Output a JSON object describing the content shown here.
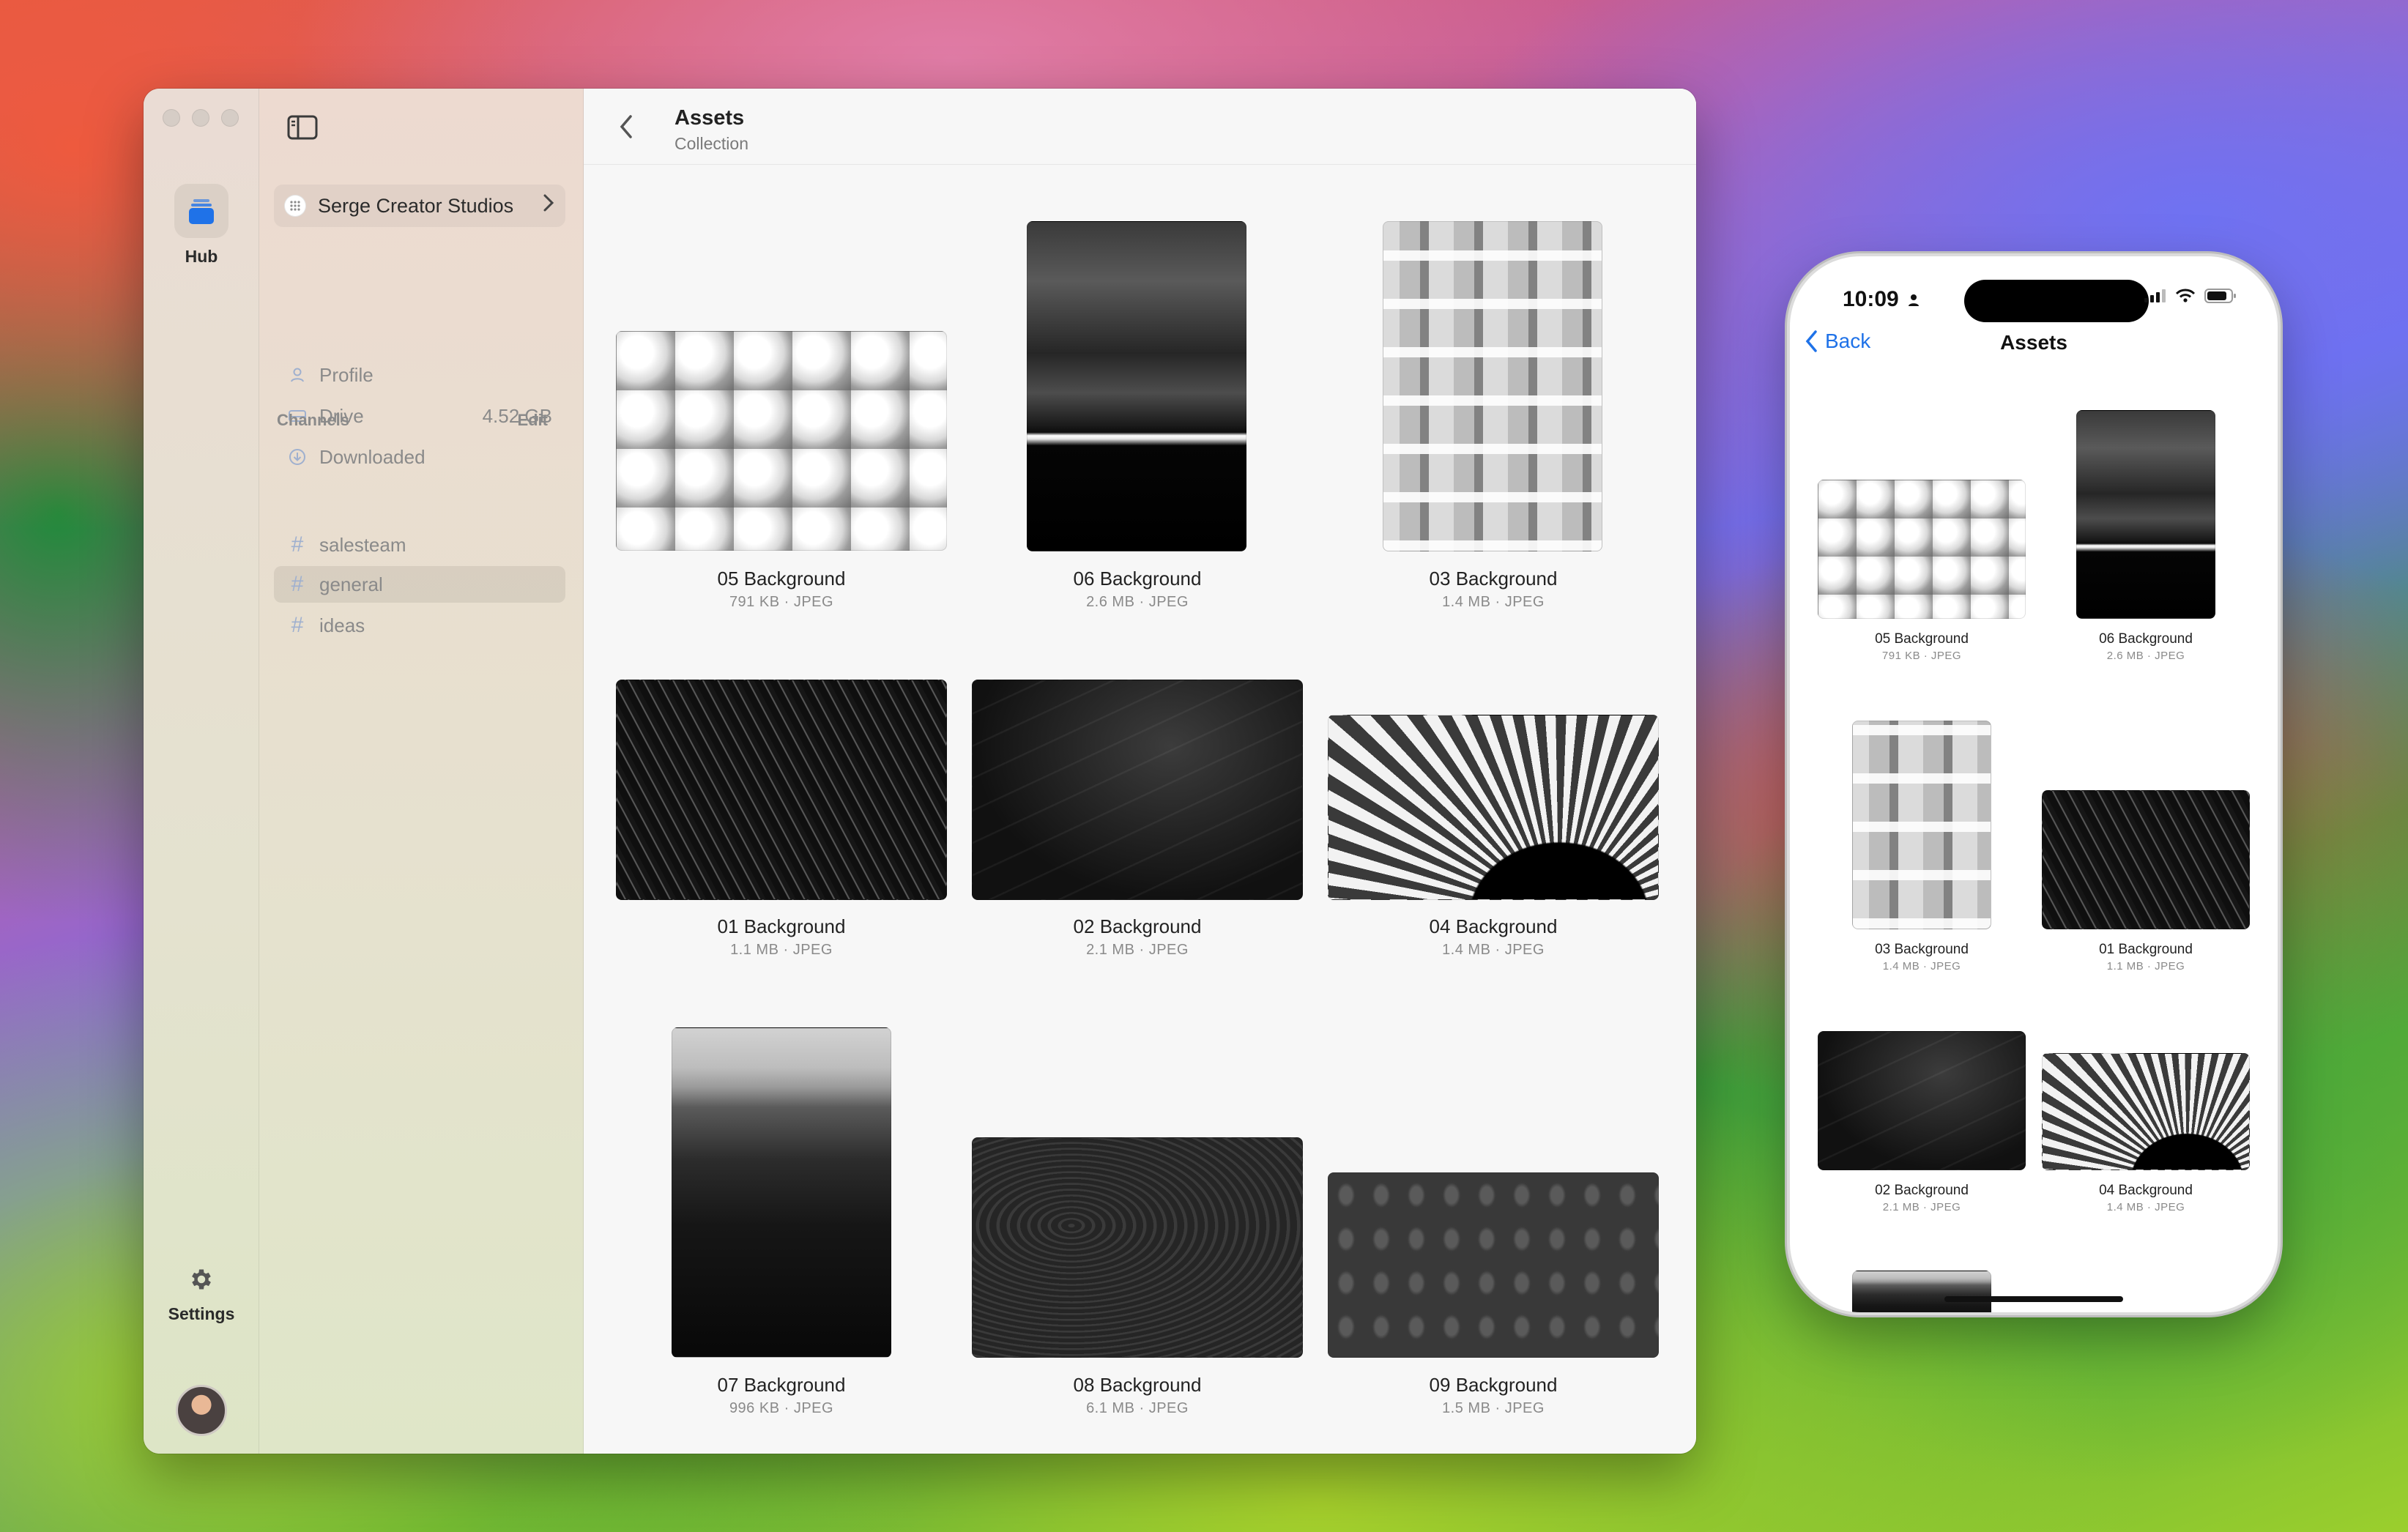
{
  "mac": {
    "rail": {
      "hub_label": "Hub",
      "settings_label": "Settings"
    },
    "sidebar": {
      "org_name": "Serge Creator Studios",
      "items": [
        {
          "label": "Profile",
          "icon": "person-icon"
        },
        {
          "label": "Drive",
          "icon": "drive-icon",
          "meta": "4.52 GB"
        },
        {
          "label": "Downloaded",
          "icon": "download-icon"
        }
      ],
      "channels_heading": "Channels",
      "channels_edit": "Edit",
      "channels": [
        {
          "label": "salesteam"
        },
        {
          "label": "general",
          "selected": true
        },
        {
          "label": "ideas"
        }
      ]
    },
    "header": {
      "title": "Assets",
      "subtitle": "Collection"
    },
    "assets": [
      {
        "name": "05 Background",
        "meta": "791 KB · JPEG"
      },
      {
        "name": "06 Background",
        "meta": "2.6 MB · JPEG"
      },
      {
        "name": "03 Background",
        "meta": "1.4 MB · JPEG"
      },
      {
        "name": "01 Background",
        "meta": "1.1 MB · JPEG"
      },
      {
        "name": "02 Background",
        "meta": "2.1 MB · JPEG"
      },
      {
        "name": "04 Background",
        "meta": "1.4 MB · JPEG"
      },
      {
        "name": "07 Background",
        "meta": "996 KB · JPEG"
      },
      {
        "name": "08 Background",
        "meta": "6.1 MB · JPEG"
      },
      {
        "name": "09 Background",
        "meta": "1.5 MB · JPEG"
      }
    ]
  },
  "phone": {
    "time": "10:09",
    "back_label": "Back",
    "title": "Assets",
    "assets": [
      {
        "name": "05 Background",
        "meta": "791 KB · JPEG"
      },
      {
        "name": "06 Background",
        "meta": "2.6 MB · JPEG"
      },
      {
        "name": "03 Background",
        "meta": "1.4 MB · JPEG"
      },
      {
        "name": "01 Background",
        "meta": "1.1 MB · JPEG"
      },
      {
        "name": "02 Background",
        "meta": "2.1 MB · JPEG"
      },
      {
        "name": "04 Background",
        "meta": "1.4 MB · JPEG"
      }
    ]
  },
  "colors": {
    "accent": "#1f72e8",
    "hub_icon": "#1f72e8"
  }
}
